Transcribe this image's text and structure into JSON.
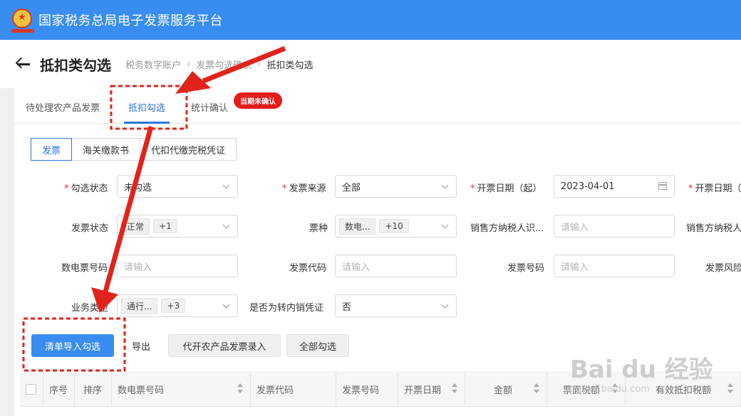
{
  "app": {
    "title": "国家税务总局电子发票服务平台"
  },
  "page": {
    "title": "抵扣类勾选"
  },
  "breadcrumb": [
    "税务数字账户",
    "发票勾选确认",
    "抵扣类勾选"
  ],
  "tabs": [
    "待处理农产品发票",
    "抵扣勾选",
    "统计确认"
  ],
  "tab_badge": "当期未确认",
  "subtabs": [
    "发票",
    "海关缴款书",
    "代扣代缴完税凭证"
  ],
  "filters": {
    "check_status": {
      "label": "勾选状态",
      "value": "未勾选"
    },
    "invoice_source": {
      "label": "发票来源",
      "value": "全部"
    },
    "date_start": {
      "label": "开票日期（起）",
      "value": "2023-04-01"
    },
    "date_end": {
      "label": "开票日期（"
    },
    "invoice_status": {
      "label": "发票状态",
      "tag": "正常",
      "more": "+1"
    },
    "invoice_type": {
      "label": "票种",
      "tag": "数电...",
      "more": "+10"
    },
    "seller_tax_id": {
      "label": "销售方纳税人识...",
      "placeholder": "请输入"
    },
    "seller_name": {
      "label": "销售方纳税人"
    },
    "digital_number": {
      "label": "数电票号码",
      "placeholder": "请输入"
    },
    "invoice_code": {
      "label": "发票代码",
      "placeholder": "请输入"
    },
    "invoice_number": {
      "label": "发票号码",
      "placeholder": "请输入"
    },
    "invoice_risk": {
      "label": "发票风险"
    },
    "business_type": {
      "label": "业务类型",
      "tag": "通行...",
      "more": "+3"
    },
    "transfer_out": {
      "label": "是否为转内销凭证",
      "value": "否"
    }
  },
  "buttons": {
    "import": "清单导入勾选",
    "export": "导出",
    "agri_entry": "代开农产品发票录入",
    "select_all": "全部勾选"
  },
  "table": {
    "headers": [
      "序号",
      "排序",
      "数电票号码",
      "发票代码",
      "发票号码",
      "开票日期",
      "金额",
      "票面税额",
      "有效抵扣税额"
    ]
  },
  "watermark": {
    "main": "Bai du 经验",
    "sub": "jingyan.baidu.com"
  },
  "colors": {
    "primary": "#3a8df0",
    "annotation_red": "#e0241b",
    "badge": "#e31c1c"
  }
}
